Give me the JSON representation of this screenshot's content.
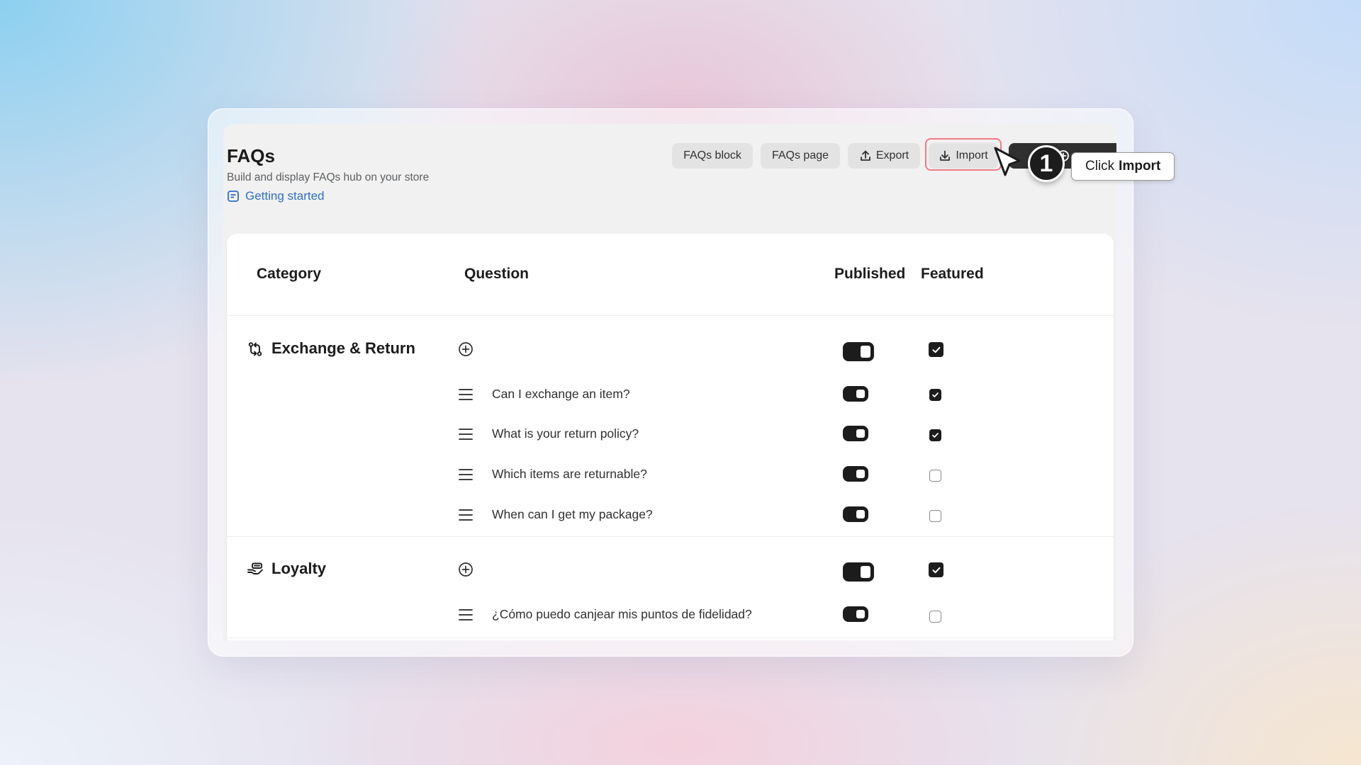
{
  "page": {
    "title": "FAQs",
    "subtitle": "Build and display FAQs hub on your store",
    "getting_started_label": "Getting started"
  },
  "header_actions": {
    "faqs_block_label": "FAQs block",
    "faqs_page_label": "FAQs page",
    "export_label": "Export",
    "import_label": "Import"
  },
  "table": {
    "columns": {
      "category": "Category",
      "question": "Question",
      "published": "Published",
      "featured": "Featured"
    },
    "categories": [
      {
        "name": "Exchange & Return",
        "icon": "exchange-icon",
        "published": true,
        "featured": true,
        "questions": [
          {
            "text": "Can I exchange an item?",
            "published": true,
            "featured": true
          },
          {
            "text": "What is your return policy?",
            "published": true,
            "featured": true
          },
          {
            "text": "Which items are returnable?",
            "published": true,
            "featured": false
          },
          {
            "text": "When can I get my package?",
            "published": true,
            "featured": false
          }
        ]
      },
      {
        "name": "Loyalty",
        "icon": "loyalty-icon",
        "published": true,
        "featured": true,
        "questions": [
          {
            "text": "¿Cómo puedo canjear mis puntos de fidelidad?",
            "published": true,
            "featured": false
          }
        ]
      }
    ]
  },
  "guide": {
    "step_number": "1",
    "tooltip_prefix": "Click",
    "tooltip_target": "Import"
  },
  "colors": {
    "accent_link": "#2c6ecb",
    "highlight": "#f07c83",
    "toggle_on": "#1c1c1c"
  }
}
